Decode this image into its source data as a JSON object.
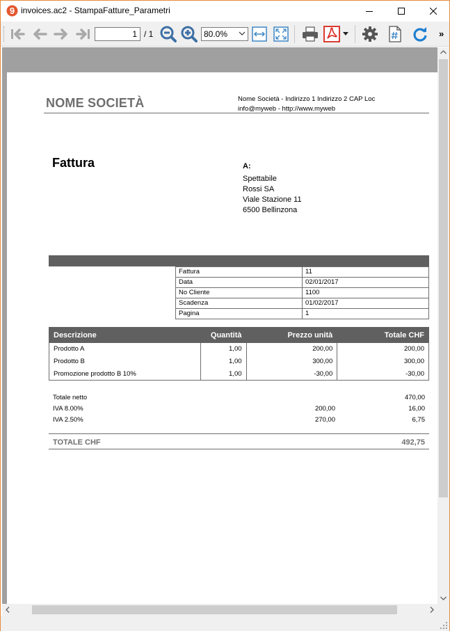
{
  "window": {
    "title": "invoices.ac2 - StampaFatture_Parametri"
  },
  "toolbar": {
    "page_current": "1",
    "page_total": "/ 1",
    "zoom": "80.0%",
    "overflow": "»",
    "icons": [
      "first-page-icon",
      "previous-page-icon",
      "next-page-icon",
      "last-page-icon",
      "zoom-out-icon",
      "zoom-in-icon",
      "fit-width-icon",
      "fit-page-icon",
      "print-icon",
      "pdf-icon",
      "pdf-dropdown-icon",
      "settings-icon",
      "page-number-icon",
      "refresh-icon"
    ]
  },
  "colors": {
    "frame_border": "#e48c3c",
    "header_gray": "#606060",
    "company_gray": "#6e6e6e",
    "pdf_red": "#d9261c",
    "refresh_blue": "#1e7fd0"
  },
  "invoice": {
    "company_name": "NOME SOCIETÀ",
    "company_line1": "Nome Società - Indirizzo 1 Indirizzo 2 CAP Loc",
    "company_line2": "info@myweb - http://www.myweb",
    "doc_title": "Fattura",
    "address_label": "A:",
    "address_lines": [
      "Spettabile",
      "Rossi SA",
      "Viale Stazione 11",
      "6500 Bellinzona"
    ],
    "info": [
      {
        "key": "Fattura",
        "value": "11"
      },
      {
        "key": "Data",
        "value": "02/01/2017"
      },
      {
        "key": "No Cliente",
        "value": "1100"
      },
      {
        "key": "Scadenza",
        "value": "01/02/2017"
      },
      {
        "key": "Pagina",
        "value": "1"
      }
    ],
    "columns": [
      "Descrizione",
      "Quantità",
      "Prezzo unità",
      "Totale CHF"
    ],
    "rows": [
      {
        "desc": "Prodotto A",
        "qty": "1,00",
        "price": "200,00",
        "total": "200,00"
      },
      {
        "desc": "Prodotto B",
        "qty": "1,00",
        "price": "300,00",
        "total": "300,00"
      },
      {
        "desc": "Promozione prodotto B 10%",
        "qty": "1,00",
        "price": "-30,00",
        "total": "-30,00"
      }
    ],
    "totals": [
      {
        "label": "Totale netto",
        "base": "",
        "value": "470,00"
      },
      {
        "label": "IVA 8.00%",
        "base": "200,00",
        "value": "16,00"
      },
      {
        "label": "IVA 2.50%",
        "base": "270,00",
        "value": "6,75"
      }
    ],
    "grand_label": "TOTALE CHF",
    "grand_value": "492,75"
  }
}
